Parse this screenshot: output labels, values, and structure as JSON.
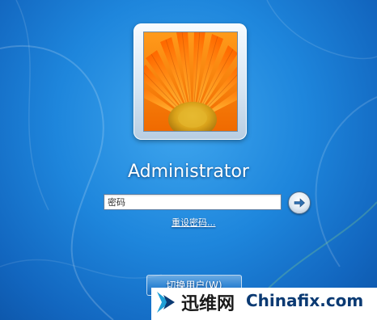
{
  "login": {
    "username": "Administrator",
    "password_placeholder": "密码",
    "password_value": "",
    "reset_link": "重设密码...",
    "switch_user_label": "切换用户(W)"
  },
  "watermark": {
    "chinese_text": "迅维网",
    "english_text": "Chinafix.com"
  },
  "icons": {
    "go": "arrow-right-icon",
    "avatar": "orange-flower-picture",
    "watermark_logo": "arrow-logo"
  },
  "colors": {
    "background": "#1e86dc",
    "text": "#ffffff",
    "watermark_brand": "#0b3a73"
  }
}
